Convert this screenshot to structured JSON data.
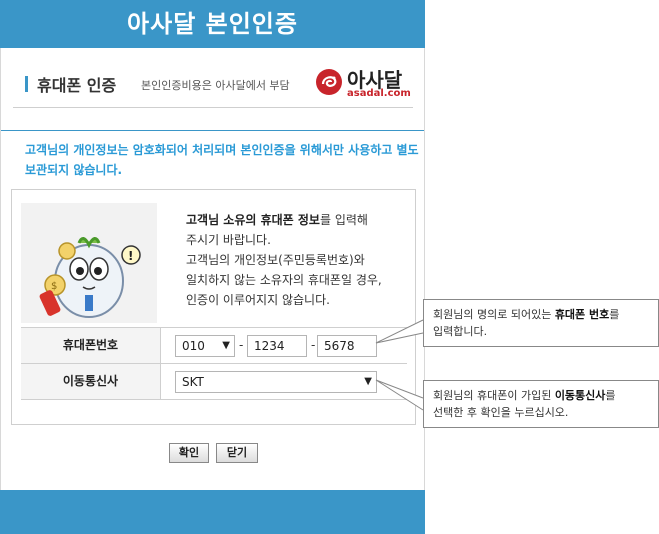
{
  "header": {
    "title": "아사달 본인인증"
  },
  "section": {
    "title": "휴대폰 인증",
    "subtitle": "본인인증비용은 아사달에서 부담",
    "logo_text": "아사달",
    "logo_sub": "asadal.com"
  },
  "notice": {
    "text": "고객님의 개인정보는 암호화되어 처리되며 본인인증을 위해서만 사용하고 별도 보관되지 않습니다."
  },
  "info": {
    "line1_bold": "고객님 소유의 휴대폰 정보",
    "line1_rest": "를 입력해",
    "line2": "주시기 바랍니다.",
    "line3": "고객님의 개인정보(주민등록번호)와",
    "line4": "일치하지 않는 소유자의 휴대폰일 경우,",
    "line5": "인증이 이루어지지 않습니다."
  },
  "form": {
    "phone_label": "휴대폰번호",
    "phone_prefix": "010",
    "phone_middle": "1234",
    "phone_last": "5678",
    "dash": "-",
    "carrier_label": "이동통신사",
    "carrier_value": "SKT"
  },
  "buttons": {
    "confirm": "확인",
    "close": "닫기"
  },
  "tips": {
    "phone_pre": "회원님의 명의로 되어있는 ",
    "phone_bold": "휴대폰 번호",
    "phone_post": "를",
    "phone_line2": "입력합니다.",
    "carrier_pre": "회원님의 휴대폰이 가입된 ",
    "carrier_bold": "이동통신사",
    "carrier_post": "를",
    "carrier_line2": "선택한 후 확인을 누르십시오."
  },
  "icons": {
    "select_arrow": "▼"
  },
  "colors": {
    "accent": "#3a96c8",
    "notice": "#2a9ad6",
    "logo_red": "#c8242b"
  }
}
